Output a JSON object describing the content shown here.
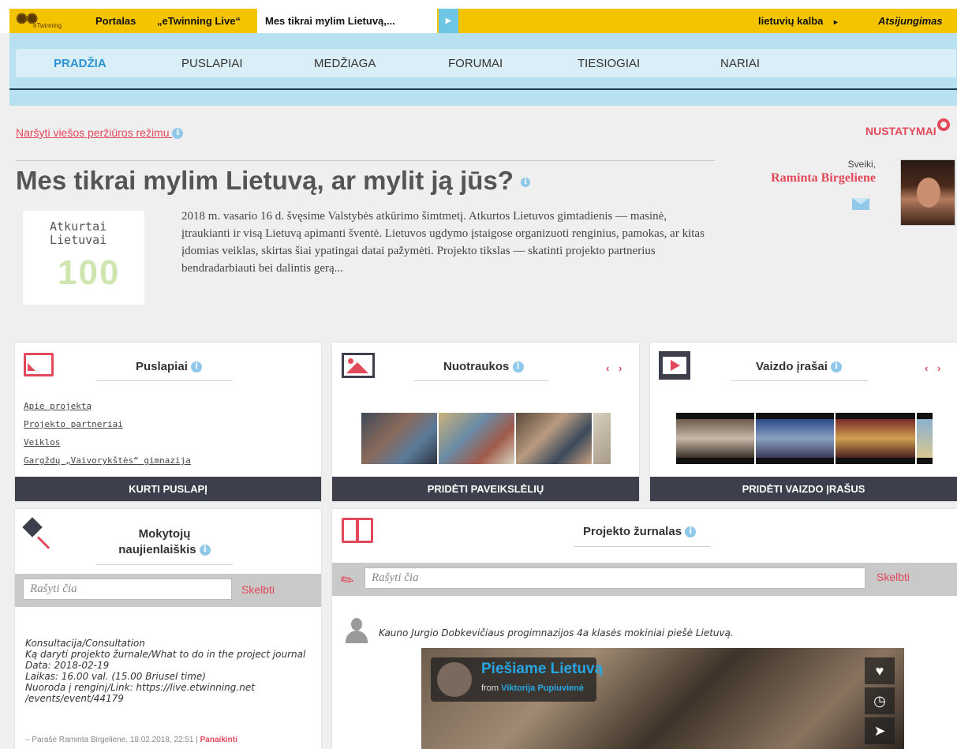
{
  "topbar": {
    "logo_text": "eTwinning",
    "portal": "Portalas",
    "live": "„eTwinning Live“",
    "active_tab": "Mes tikrai mylim Lietuvą,...",
    "language": "lietuvių kalba",
    "language_arrow": "►",
    "logout": "Atsijungimas"
  },
  "nav": {
    "items": [
      "PRADŽIA",
      "PUSLAPIAI",
      "MEDŽIAGA",
      "FORUMAI",
      "TIESIOGIAI",
      "NARIAI"
    ],
    "active": "PRADŽIA"
  },
  "header": {
    "public_view": "Naršyti viešos peržiūros režimu",
    "settings": "NUSTATYMAI",
    "title": "Mes tikrai mylim Lietuvą, ar mylit ją jūs?",
    "logo_line1": "Atkurtai",
    "logo_line2": "Lietuvai",
    "logo_number": "100",
    "description": "2018 m. vasario 16 d. švęsime Valstybės atkūrimo šimtmetį. Atkurtos Lietuvos gimtadienis — masinė, įtraukianti ir visą Lietuvą apimanti šventė. Lietuvos ugdymo įstaigose organizuoti renginius, pamokas, ar kitas įdomias veiklas, skirtas šiai ypatingai datai pažymėti. Projekto tikslas — skatinti projekto partnerius bendradarbiauti bei dalintis gerą...",
    "greeting": "Sveiki,",
    "user_name": "Raminta Birgeliene"
  },
  "pages_card": {
    "title": "Puslapiai",
    "links": [
      "Apie projektą",
      "Projekto partneriai",
      "Veiklos",
      "Gargždų „Vaivorykštės“ gimnazija"
    ],
    "button": "KURTI PUSLAPĮ"
  },
  "photos_card": {
    "title": "Nuotraukos",
    "prev": "‹",
    "next": "›",
    "button": "PRIDĖTI PAVEIKSLĖLIŲ"
  },
  "videos_card": {
    "title": "Vaizdo įrašai",
    "prev": "‹",
    "next": "›",
    "button": "PRIDĖTI VAIZDO ĮRAŠUS"
  },
  "newsletter_card": {
    "title_line1": "Mokytojų",
    "title_line2": "naujienlaiškis",
    "input_placeholder": "Rašyti čia",
    "post": "Skelbti",
    "entry_lines": [
      "Konsultacija/Consultation",
      "Ką daryti projekto žurnale/What to do in the project journal",
      "Data: 2018-02-19",
      "Laikas: 16.00 val. (15.00 Briusel time)",
      "Nuoroda į renginį/Link: https://live.etwinning.net",
      "/events/event/44179"
    ],
    "meta": "– Parašė Raminta Birgeliene, 18.02.2018, 22:51 |",
    "meta_action": "Panaikinti"
  },
  "journal_card": {
    "title": "Projekto žurnalas",
    "input_placeholder": "Rašyti čia",
    "post": "Skelbti",
    "post_text": "Kauno Jurgio Dobkevičiaus progimnazijos 4a klasės mokiniai piešė Lietuvą.",
    "video_title": "Piešiame Lietuvą",
    "video_from_label": "from",
    "video_author": "Viktorija Pupiuvienė",
    "video_actions": [
      "heart-icon",
      "clock-icon",
      "send-icon"
    ]
  },
  "colors": {
    "top_yellow": "#f5c400",
    "nav_blue": "#b7e1f1",
    "accent_red": "#e2495a",
    "dark_button": "#3d3f4c",
    "active_nav": "#2b95d3"
  }
}
